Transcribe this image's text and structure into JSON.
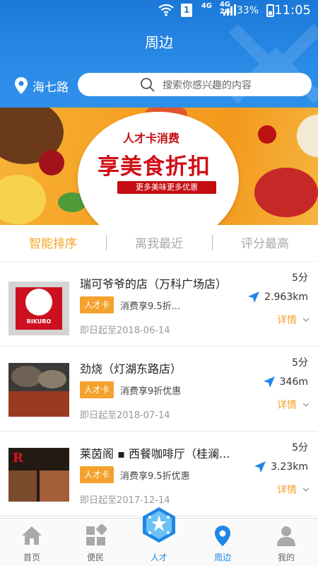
{
  "status_bar": {
    "network_a": "4G",
    "network_b": "4G",
    "network_c": "2G",
    "sim": "1",
    "battery": "33%",
    "time": "11:05"
  },
  "header": {
    "title": "周边",
    "location": "海七路",
    "search_placeholder": "搜索你感兴趣的内容"
  },
  "banner": {
    "subtitle": "人才卡消费",
    "title": "享美食折扣",
    "slogan": "更多美味更多优惠"
  },
  "tabs": [
    {
      "label": "智能排序",
      "active": true
    },
    {
      "label": "离我最近",
      "active": false
    },
    {
      "label": "评分最高",
      "active": false
    }
  ],
  "items": [
    {
      "name": "瑞可爷爷的店（万科广场店）",
      "badge": "人才卡",
      "offer": "消费享9.5折...",
      "date": "即日起至2018-06-14",
      "score": "5分",
      "distance": "2.963km",
      "detail": "详情",
      "logo_text": "RIKURO"
    },
    {
      "name": "劲烧（灯湖东路店）",
      "badge": "人才卡",
      "offer": "消费享9折优惠",
      "date": "即日起至2018-07-14",
      "score": "5分",
      "distance": "346m",
      "detail": "详情"
    },
    {
      "name": "莱茵阁 ▪ 西餐咖啡厅（桂澜...",
      "badge": "人才卡",
      "offer": "消费享9.5折优惠",
      "date": "即日起至2017-12-14",
      "score": "5分",
      "distance": "3.23km",
      "detail": "详情"
    }
  ],
  "bottom_nav": [
    {
      "label": "首页",
      "icon": "home-icon"
    },
    {
      "label": "便民",
      "icon": "grid-icon"
    },
    {
      "label": "人才",
      "icon": "star-badge-icon"
    },
    {
      "label": "周边",
      "icon": "location-pin-icon",
      "active": true
    },
    {
      "label": "我的",
      "icon": "person-icon"
    }
  ],
  "colors": {
    "primary_blue": "#2a8be7",
    "accent_orange": "#f4a22d",
    "active_tab": "#f5a623"
  }
}
